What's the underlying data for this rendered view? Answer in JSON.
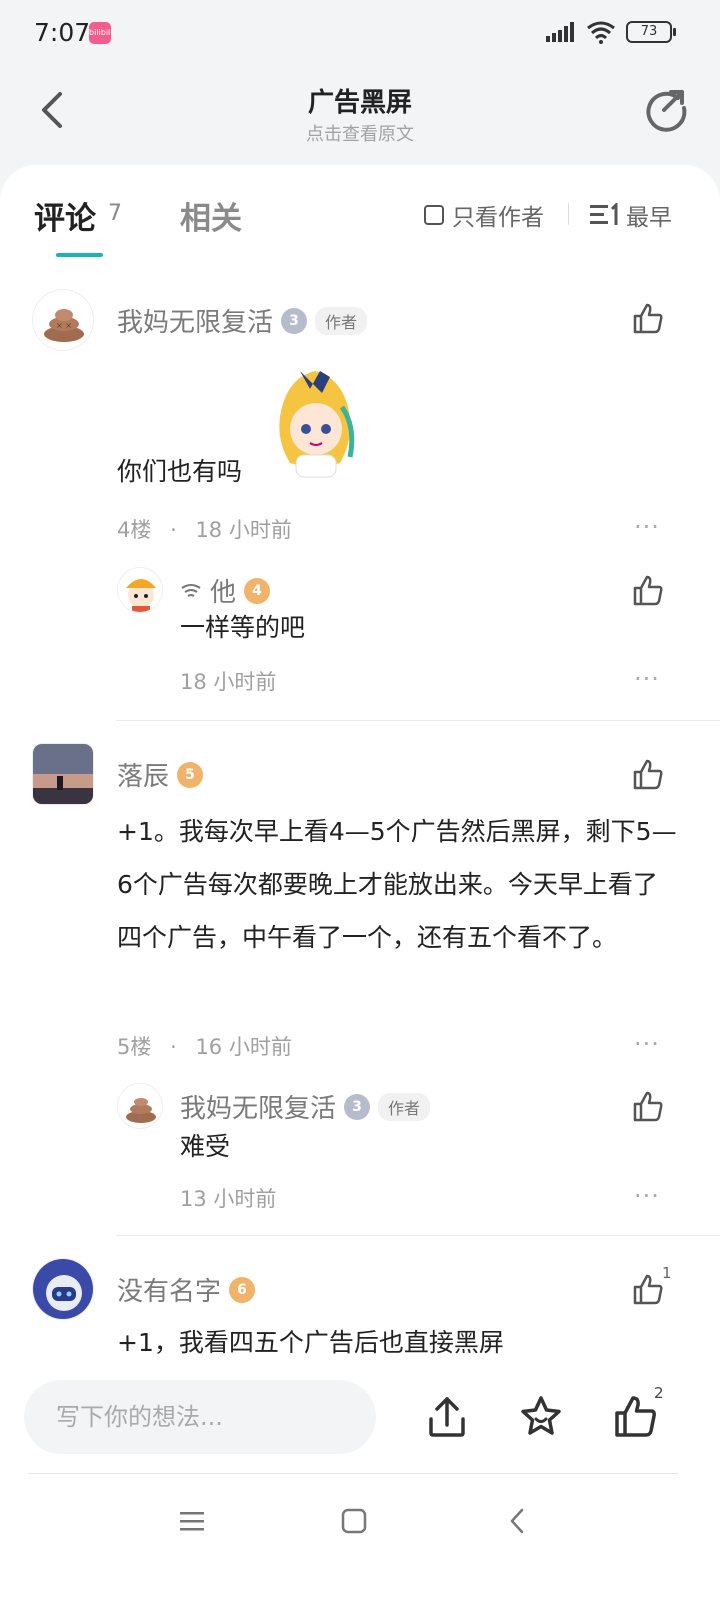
{
  "status_bar": {
    "time": "7:07",
    "app_badge": "bilibili",
    "battery": "73"
  },
  "header": {
    "title": "广告黑屏",
    "subtitle": "点击查看原文"
  },
  "tabs": {
    "comments_label": "评论",
    "comments_count": "7",
    "related_label": "相关",
    "author_only_label": "只看作者",
    "sort_label": "最早"
  },
  "comments": [
    {
      "user": "我妈无限复活",
      "level": "3",
      "author_tag": "作者",
      "text": "你们也有吗",
      "floor": "4楼",
      "time": "18 小时前",
      "reply": {
        "user": "他",
        "level": "4",
        "text": "一样等的吧",
        "time": "18 小时前"
      }
    },
    {
      "user": "落辰",
      "level": "5",
      "text": "+1。我每次早上看4—5个广告然后黑屏，剩下5—6个广告每次都要晚上才能放出来。今天早上看了四个广告，中午看了一个，还有五个看不了。",
      "floor": "5楼",
      "time": "16 小时前",
      "reply": {
        "user": "我妈无限复活",
        "level": "3",
        "author_tag": "作者",
        "text": "难受",
        "time": "13 小时前"
      }
    },
    {
      "user": "没有名字",
      "level": "6",
      "like_count": "1",
      "text": "+1，我看四五个广告后也直接黑屏"
    }
  ],
  "separators": {
    "dot": "·",
    "more": "···"
  },
  "bottom_bar": {
    "input_placeholder": "写下你的想法...",
    "like_count": "2"
  },
  "colors": {
    "accent": "#19b4b8",
    "level_gold": "#f1b26a",
    "level_silver": "#b7bccc"
  }
}
